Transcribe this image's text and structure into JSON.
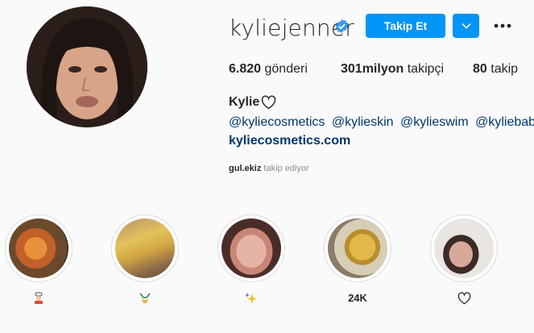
{
  "profile": {
    "username": "kyliejenner",
    "follow_label": "Takip Et",
    "stats": {
      "posts_count": "6.820",
      "posts_label": "gönderi",
      "followers_count": "301milyon",
      "followers_label": "takipçi",
      "following_count": "80",
      "following_label": "takip"
    },
    "full_name": "Kylie",
    "mentions": [
      "@kyliecosmetics",
      "@kylieskin",
      "@kylieswim",
      "@kyliebaby"
    ],
    "website": "kyliecosmetics.com",
    "followed_by_user": "gul.ekiz",
    "followed_by_text": "takip ediyor"
  },
  "highlights": [
    {
      "label": "",
      "icon": "cook-icon"
    },
    {
      "label": "",
      "icon": "bikini-icon"
    },
    {
      "label": "",
      "icon": "sparkles-icon"
    },
    {
      "label": "24K",
      "icon": ""
    },
    {
      "label": "",
      "icon": "heart-outline-icon"
    }
  ],
  "colors": {
    "accent": "#0095f6",
    "link": "#00376b",
    "muted": "#8e8e8e"
  }
}
